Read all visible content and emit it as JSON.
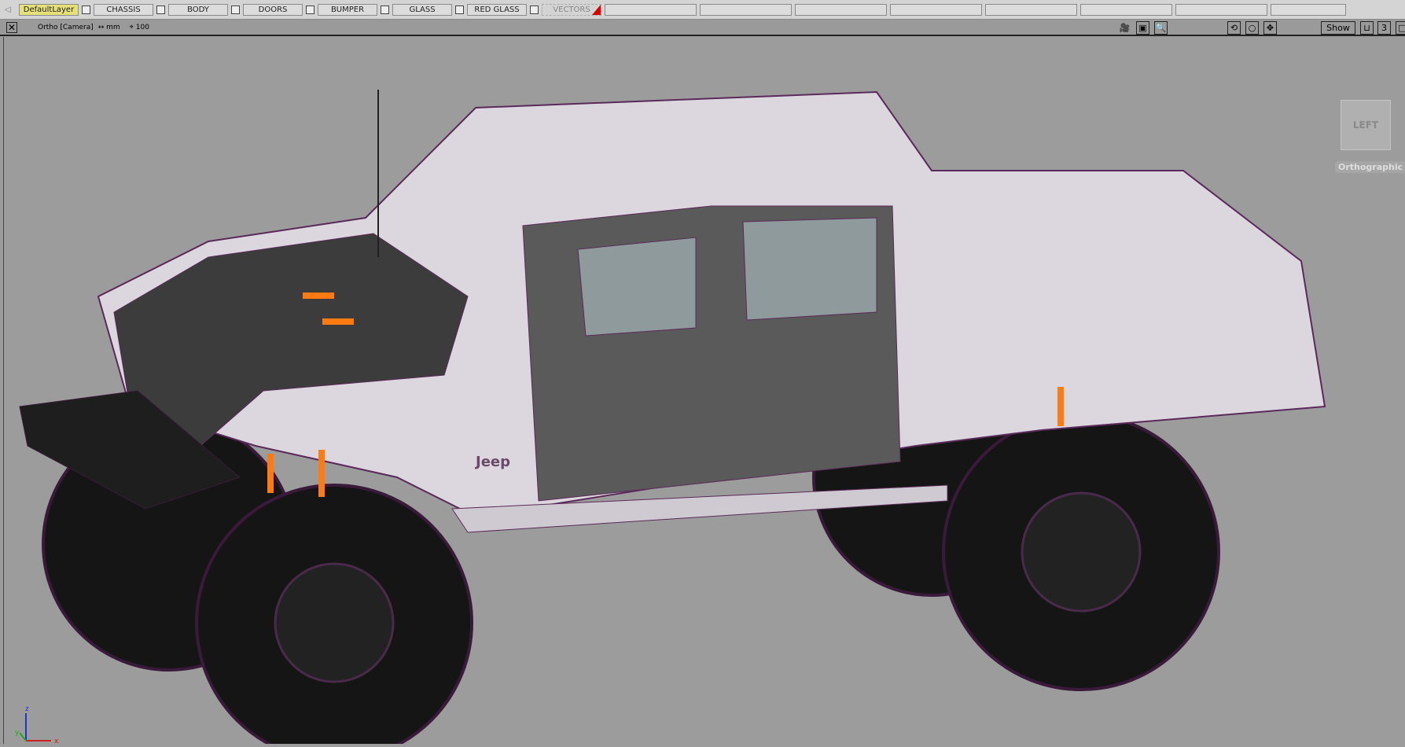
{
  "layers": {
    "items": [
      "DefaultLayer",
      "CHASSIS",
      "BODY",
      "DOORS",
      "BUMPER",
      "GLASS",
      "RED GLASS",
      "VECTORS"
    ],
    "active": "DefaultLayer",
    "active_color": "#e6e07a"
  },
  "viewbar": {
    "camera": "Ortho [Camera]",
    "units": "↔ mm",
    "grid": "100",
    "show_label": "Show",
    "view_count": "3"
  },
  "viewport": {
    "view_cube_label": "LEFT",
    "projection": "Orthographic",
    "axis_labels": {
      "z": "z",
      "y": "y",
      "x": "x"
    },
    "background": "#9c9c9c",
    "model_brand": "Jeep"
  }
}
